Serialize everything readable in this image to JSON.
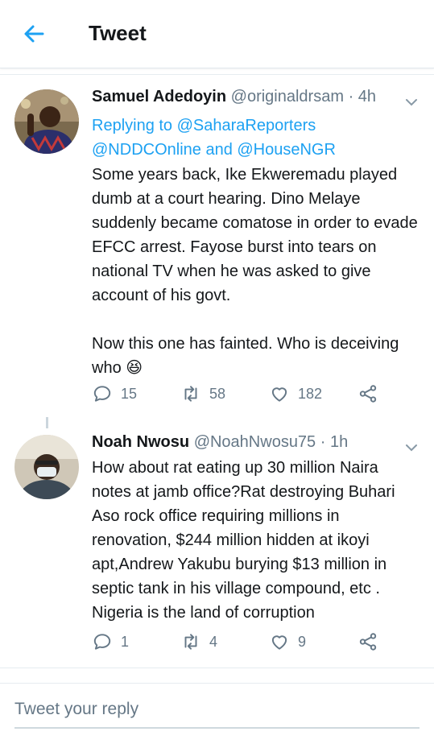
{
  "header": {
    "title": "Tweet"
  },
  "tweets": [
    {
      "name": "Samuel Adedoyin",
      "handle": "@originaldrsam",
      "dot": "·",
      "time": "4h",
      "replying_prefix": "Replying to",
      "replying_1": "@SaharaReporters",
      "replying_2": "@NDDCOnline and @HouseNGR",
      "text_p1": "Some years back, Ike Ekweremadu played dumb at a court hearing. Dino Melaye suddenly became comatose in order to evade EFCC arrest. Fayose burst into tears on national TV when he was asked to give account of his govt.",
      "text_p2": "Now this one has fainted. Who is deceiving who 😆",
      "replies": "15",
      "retweets": "58",
      "likes": "182"
    },
    {
      "name": "Noah Nwosu",
      "handle": "@NoahNwosu75",
      "dot": "·",
      "time": "1h",
      "text": "How about rat eating up 30 million Naira notes at jamb office?Rat destroying Buhari Aso rock office requiring millions in renovation, $244 million hidden at ikoyi apt,Andrew Yakubu burying $13 million in septic tank in his village compound, etc . Nigeria is the land of corruption",
      "replies": "1",
      "retweets": "4",
      "likes": "9"
    }
  ],
  "reply_bar": {
    "placeholder": "Tweet your reply"
  },
  "colors": {
    "accent": "#1da1f2",
    "muted": "#657786",
    "text": "#14171a"
  }
}
